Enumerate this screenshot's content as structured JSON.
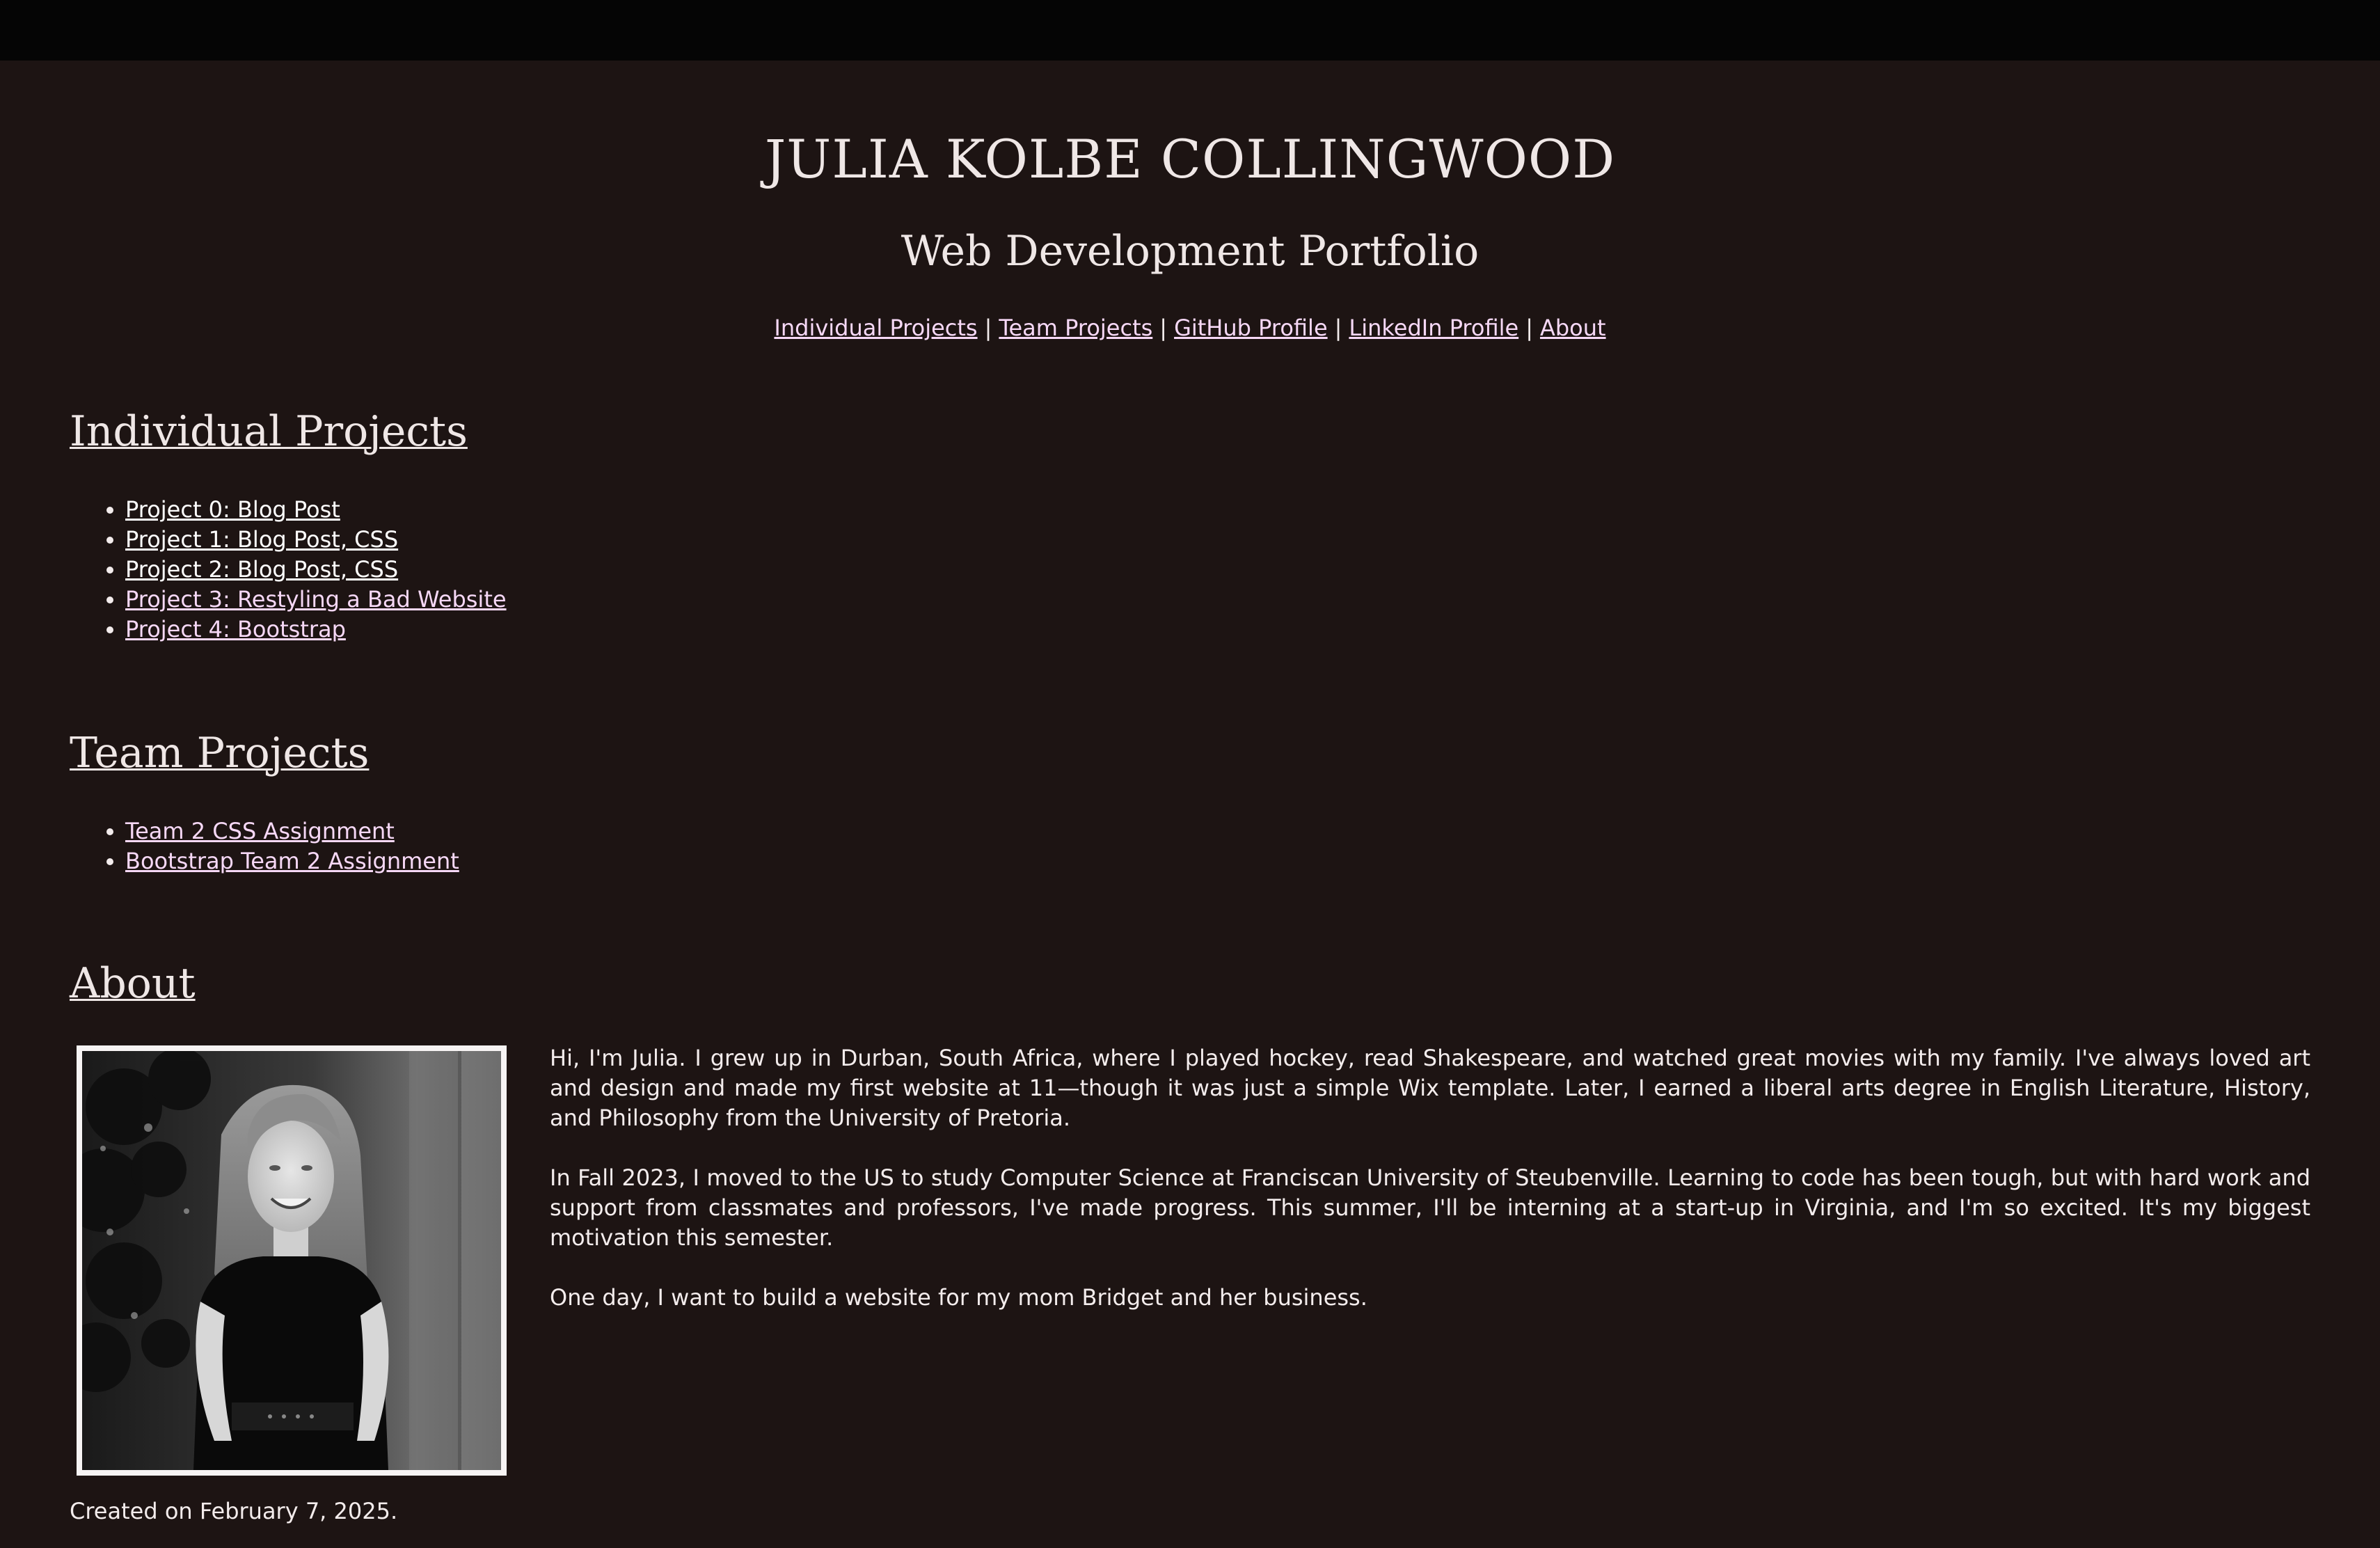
{
  "header": {
    "title": "JULIA KOLBE COLLINGWOOD",
    "subtitle": "Web Development Portfolio"
  },
  "nav": {
    "items": [
      {
        "label": "Individual Projects"
      },
      {
        "label": "Team Projects"
      },
      {
        "label": "GitHub Profile"
      },
      {
        "label": "LinkedIn Profile"
      },
      {
        "label": "About"
      }
    ],
    "separator": "|"
  },
  "individual_projects": {
    "heading": "Individual Projects",
    "items": [
      {
        "label": "Project 0: Blog Post"
      },
      {
        "label": "Project 1: Blog Post, CSS"
      },
      {
        "label": "Project 2: Blog Post, CSS"
      },
      {
        "label": "Project 3: Restyling a Bad Website"
      },
      {
        "label": "Project 4: Bootstrap"
      }
    ]
  },
  "team_projects": {
    "heading": "Team Projects",
    "items": [
      {
        "label": "Team 2 CSS Assignment"
      },
      {
        "label": "Bootstrap Team 2 Assignment"
      }
    ]
  },
  "about": {
    "heading": "About",
    "paragraphs": [
      "Hi, I'm Julia. I grew up in Durban, South Africa, where I played hockey, read Shakespeare, and watched great movies with my family. I've always loved art and design and made my first website at 11—though it was just a simple Wix template. Later, I earned a liberal arts degree in English Literature, History, and Philosophy from the University of Pretoria.",
      "In Fall 2023, I moved to the US to study Computer Science at Franciscan University of Steubenville. Learning to code has been tough, but with hard work and support from classmates and professors, I've made progress. This summer, I'll be interning at a start-up in Virginia, and I'm so excited. It's my biggest motivation this semester.",
      "One day, I want to build a website for my mom Bridget and her business."
    ]
  },
  "footer": {
    "created": "Created on February 7, 2025."
  },
  "colors": {
    "background": "#1d1413",
    "topbar": "#050505",
    "text": "#f3ecec",
    "link": "#f6d8f6",
    "visited_link": "#ffffff"
  }
}
